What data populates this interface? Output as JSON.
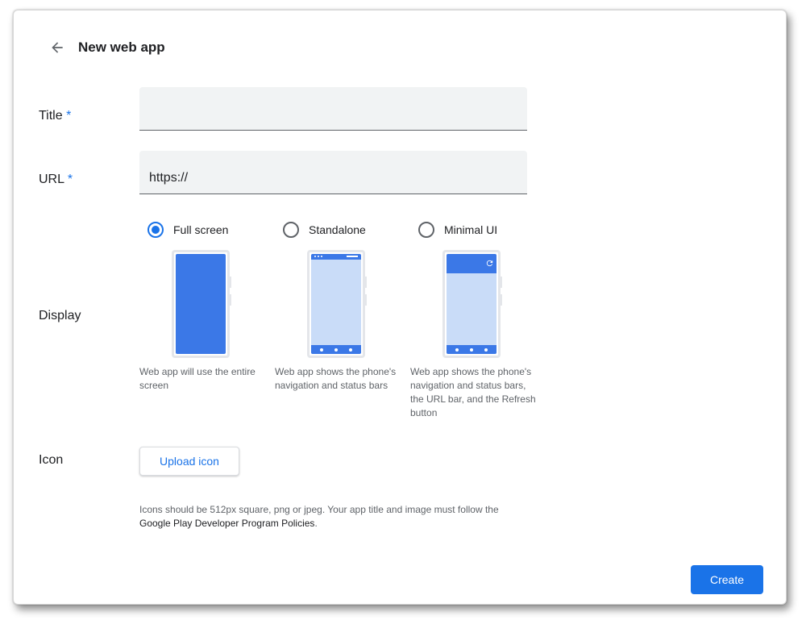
{
  "header": {
    "title": "New web app",
    "back_icon": "arrow-left-icon"
  },
  "form": {
    "title": {
      "label": "Title",
      "required_mark": "*",
      "value": ""
    },
    "url": {
      "label": "URL",
      "required_mark": "*",
      "value": "https://"
    },
    "display": {
      "label": "Display",
      "selected": "full-screen",
      "options": [
        {
          "id": "full-screen",
          "label": "Full screen",
          "description": "Web app will use the entire screen"
        },
        {
          "id": "standalone",
          "label": "Standalone",
          "description": "Web app shows the phone's navigation and status bars"
        },
        {
          "id": "minimal-ui",
          "label": "Minimal UI",
          "description": "Web app shows the phone's navigation and status bars, the URL bar, and the Refresh button"
        }
      ]
    },
    "icon": {
      "label": "Icon",
      "upload_label": "Upload icon",
      "help_text": "Icons should be 512px square, png or jpeg. Your app title and image must follow the",
      "help_link": "Google Play Developer Program Policies",
      "help_suffix": "."
    }
  },
  "actions": {
    "create_label": "Create"
  },
  "colors": {
    "accent": "#1a73e8",
    "phone_screen": "#3b78e7",
    "phone_screen_light": "#c9dcf8"
  }
}
